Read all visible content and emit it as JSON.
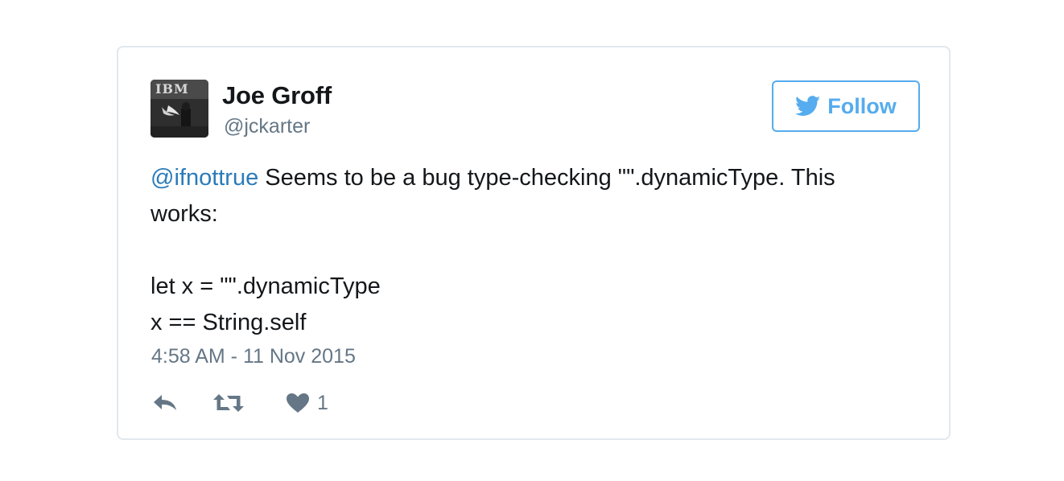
{
  "author": {
    "display_name": "Joe Groff",
    "handle": "@jckarter",
    "avatar_icon": "avatar-image"
  },
  "follow_button": {
    "label": "Follow",
    "icon": "twitter-bird-icon",
    "color": "#55acee"
  },
  "tweet": {
    "mention": "@ifnottrue",
    "text_line1": " Seems to be a bug type-checking \"\".dynamicType. This",
    "text_line2": "works:",
    "code_line1": "let x = \"\".dynamicType",
    "code_line2": "x == String.self",
    "timestamp": "4:58 AM - 11 Nov 2015"
  },
  "actions": {
    "reply_icon": "reply-icon",
    "retweet_icon": "retweet-icon",
    "like_icon": "heart-icon",
    "like_count": "1"
  },
  "colors": {
    "link": "#2b7bb9",
    "muted": "#657786",
    "border": "#e1e8ed"
  }
}
